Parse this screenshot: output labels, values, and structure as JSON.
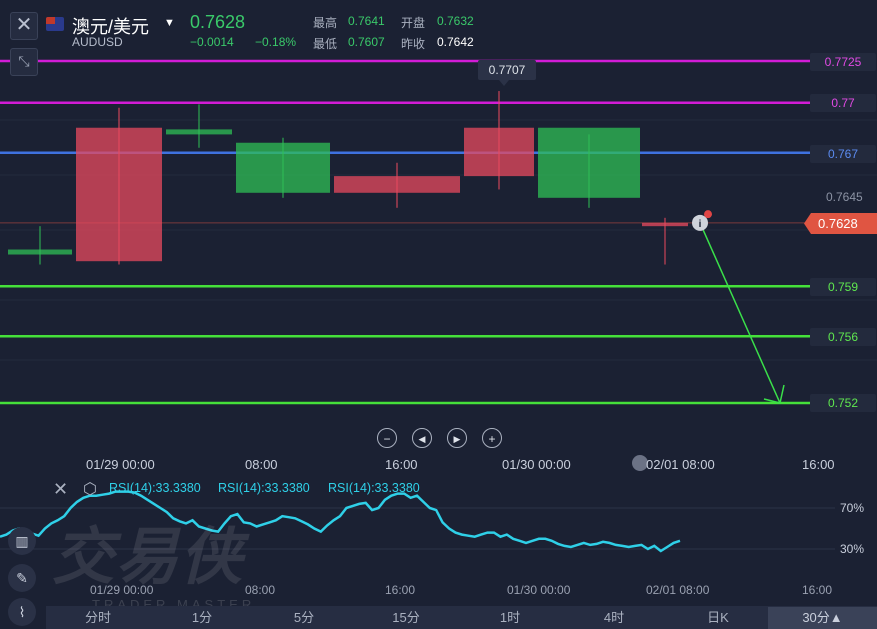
{
  "header": {
    "title": "澳元/美元",
    "symbol": "AUDUSD",
    "price": "0.7628",
    "change": "−0.0014",
    "change_pct": "−0.18%",
    "high_label": "最高",
    "high": "0.7641",
    "open_label": "开盘",
    "open": "0.7632",
    "low_label": "最低",
    "low": "0.7607",
    "prev_close_label": "昨收",
    "prev_close": "0.7642"
  },
  "colors": {
    "up": "#e84a5f",
    "down": "#2fbf55",
    "rsi": "#2fd0e8",
    "magenta": "#d21cd6",
    "blue": "#3f72e0",
    "green_level": "#45e03a",
    "current_price": "#e05542"
  },
  "chart_data": {
    "type": "candlestick",
    "y_axis_range": [
      0.751,
      0.7736
    ],
    "horizontal_lines": [
      {
        "value": 0.7725,
        "label": "0.7725",
        "color": "magenta"
      },
      {
        "value": 0.77,
        "label": "0.77",
        "color": "magenta"
      },
      {
        "value": 0.767,
        "label": "0.767",
        "color": "blue"
      },
      {
        "value": 0.759,
        "label": "0.759",
        "color": "green"
      },
      {
        "value": 0.756,
        "label": "0.756",
        "color": "green"
      },
      {
        "value": 0.752,
        "label": "0.752",
        "color": "green"
      }
    ],
    "current_price": {
      "value": 0.7628,
      "label": "0.7628"
    },
    "axis_price_tick": "0.7645",
    "callout": {
      "value": 0.7707,
      "label": "0.7707"
    },
    "clusters": [
      {
        "note": "dense run of candles, start of 01/29",
        "high": 0.7626,
        "low": 0.7603,
        "open": 0.7612,
        "close": 0.7609
      },
      {
        "note": "dense run of candles, rally toward 1/29 midday",
        "high": 0.7697,
        "low": 0.7603,
        "open": 0.7605,
        "close": 0.7685
      },
      {
        "note": "dense run of candles, 1/29 plateau",
        "high": 0.7699,
        "low": 0.7673,
        "open": 0.7684,
        "close": 0.7681
      },
      {
        "note": "dense run of candles, 1/29 afternoon decline",
        "high": 0.7679,
        "low": 0.7643,
        "open": 0.7676,
        "close": 0.7646
      },
      {
        "note": "dense run of candles, 1/29 late",
        "high": 0.7664,
        "low": 0.7637,
        "open": 0.7646,
        "close": 0.7656
      },
      {
        "note": "dense run of candles, 1/30 rally to 0.7707",
        "high": 0.7707,
        "low": 0.7648,
        "open": 0.7656,
        "close": 0.7685
      },
      {
        "note": "dense run of candles, 1/30 decline",
        "high": 0.7681,
        "low": 0.7637,
        "open": 0.7685,
        "close": 0.7643
      },
      {
        "note": "dense run of candles, 02/01 open",
        "high": 0.7631,
        "low": 0.7603,
        "open": 0.7626,
        "close": 0.7628
      }
    ],
    "projection_arrow": {
      "from": 0.7628,
      "to": 0.752
    },
    "x_ticks": [
      "01/29 00:00",
      "08:00",
      "16:00",
      "01/30 00:00",
      "02/01 08:00",
      "16:00"
    ],
    "rsi": {
      "labels": [
        "RSI(14):33.3380",
        "RSI(14):33.3380",
        "RSI(14):33.3380"
      ],
      "levels": [
        "70%",
        "30%"
      ],
      "x_ticks": [
        "01/29 00:00",
        "08:00",
        "16:00",
        "01/30 00:00",
        "02/01 08:00",
        "16:00"
      ],
      "values": [
        42,
        44,
        48,
        50,
        47,
        45,
        43,
        50,
        55,
        58,
        62,
        70,
        76,
        80,
        82,
        82,
        83,
        84,
        86,
        86,
        86,
        85,
        82,
        78,
        74,
        70,
        66,
        60,
        57,
        55,
        58,
        52,
        50,
        48,
        47,
        55,
        62,
        64,
        56,
        55,
        52,
        54,
        56,
        58,
        62,
        61,
        60,
        57,
        54,
        50,
        47,
        53,
        58,
        62,
        70,
        72,
        74,
        75,
        68,
        70,
        78,
        82,
        84,
        84,
        80,
        82,
        76,
        70,
        68,
        56,
        50,
        46,
        44,
        43,
        42,
        44,
        46,
        46,
        42,
        44,
        40,
        38,
        36,
        38,
        40,
        40,
        38,
        35,
        33,
        32,
        34,
        36,
        34,
        35,
        37,
        36,
        34,
        33,
        32,
        33,
        34,
        30,
        33,
        28,
        32,
        36,
        38
      ]
    }
  },
  "toolbar": {
    "zoom_out": "−",
    "back": "◀",
    "forward": "▶",
    "zoom_in": "+",
    "timeframes": [
      "分时",
      "1分",
      "5分",
      "15分",
      "1时",
      "4时",
      "日K",
      "30分▲"
    ]
  },
  "watermark": {
    "main": "交易侠",
    "sub": "TRADER MASTER"
  }
}
